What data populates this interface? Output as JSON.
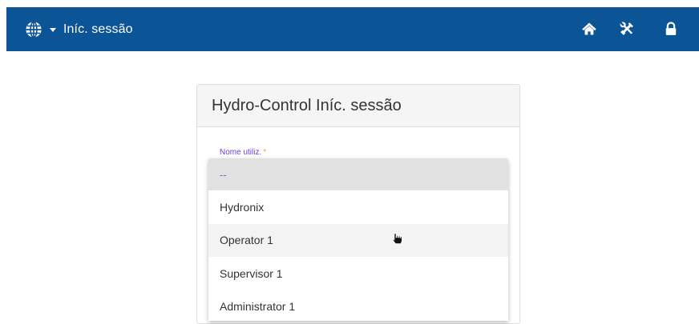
{
  "header": {
    "title": "Iníc. sessão",
    "icons": [
      "globe-icon",
      "chevron-down-icon",
      "home-icon",
      "tools-icon",
      "lock-icon"
    ],
    "bg_color": "#0b5496"
  },
  "login_panel": {
    "title": "Hydro-Control Iníc. sessão",
    "username_label": "Nome utiliz.",
    "required_marker": "*"
  },
  "username_dropdown": {
    "options": [
      "--",
      "Hydronix",
      "Operator 1",
      "Supervisor 1",
      "Administrator 1"
    ],
    "hovered_option": "Operator 1"
  }
}
